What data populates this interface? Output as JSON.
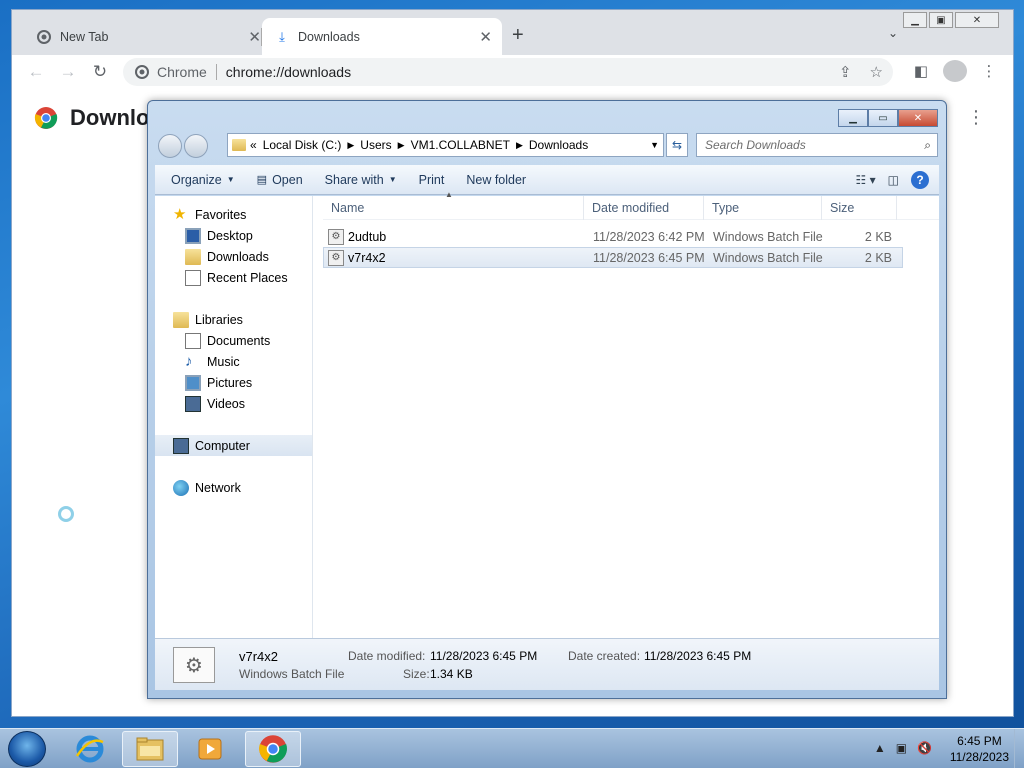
{
  "chrome": {
    "tabs": [
      {
        "label": "New Tab",
        "active": false
      },
      {
        "label": "Downloads",
        "active": true
      }
    ],
    "omnibox": {
      "chip": "Chrome",
      "url": "chrome://downloads"
    },
    "page_title": "Downlo"
  },
  "explorer": {
    "breadcrumb": [
      "Local Disk (C:)",
      "Users",
      "VM1.COLLABNET",
      "Downloads"
    ],
    "search_placeholder": "Search Downloads",
    "commands": {
      "organize": "Organize",
      "open": "Open",
      "share": "Share with",
      "print": "Print",
      "new_folder": "New folder"
    },
    "nav": {
      "favorites": "Favorites",
      "desktop": "Desktop",
      "downloads": "Downloads",
      "recent": "Recent Places",
      "libraries": "Libraries",
      "documents": "Documents",
      "music": "Music",
      "pictures": "Pictures",
      "videos": "Videos",
      "computer": "Computer",
      "network": "Network"
    },
    "columns": {
      "name": "Name",
      "date": "Date modified",
      "type": "Type",
      "size": "Size"
    },
    "files": [
      {
        "name": "2udtub",
        "date": "11/28/2023 6:42 PM",
        "type": "Windows Batch File",
        "size": "2 KB"
      },
      {
        "name": "v7r4x2",
        "date": "11/28/2023 6:45 PM",
        "type": "Windows Batch File",
        "size": "2 KB"
      }
    ],
    "details": {
      "name": "v7r4x2",
      "type": "Windows Batch File",
      "modified_label": "Date modified:",
      "modified_value": "11/28/2023 6:45 PM",
      "size_label": "Size:",
      "size_value": "1.34 KB",
      "created_label": "Date created:",
      "created_value": "11/28/2023 6:45 PM"
    }
  },
  "taskbar": {
    "time": "6:45 PM",
    "date": "11/28/2023"
  }
}
